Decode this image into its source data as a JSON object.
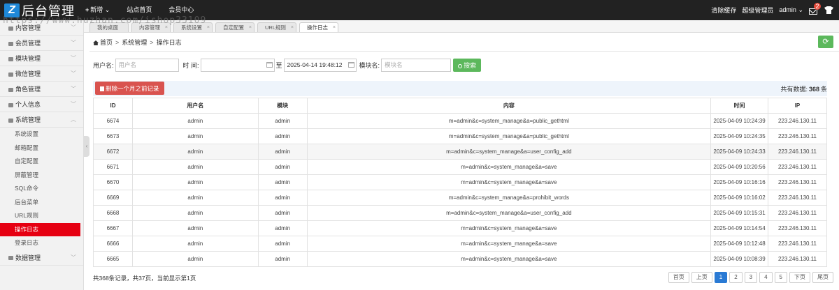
{
  "app": {
    "logo_mark": "Z",
    "logo_text": "后台管理"
  },
  "topnav": {
    "new_label": "新增",
    "site_home": "站点首页",
    "member_center": "会员中心"
  },
  "topright": {
    "clear_cache": "清除缓存",
    "role": "超级管理员",
    "user": "admin",
    "mail_count": "2"
  },
  "tabs": [
    {
      "label": "我的桌面"
    },
    {
      "label": "内容管理"
    },
    {
      "label": "系统设置"
    },
    {
      "label": "自定配置"
    },
    {
      "label": "URL规则"
    },
    {
      "label": "操作日志"
    }
  ],
  "sidebar": {
    "groups": [
      {
        "label": "内容管理"
      },
      {
        "label": "会员管理"
      },
      {
        "label": "模块管理"
      },
      {
        "label": "微信管理"
      },
      {
        "label": "角色管理"
      },
      {
        "label": "个人信息"
      },
      {
        "label": "系统管理"
      }
    ],
    "sub_items": [
      {
        "label": "系统设置"
      },
      {
        "label": "邮箱配置"
      },
      {
        "label": "自定配置"
      },
      {
        "label": "屏蔽管理"
      },
      {
        "label": "SQL命令"
      },
      {
        "label": "后台菜单"
      },
      {
        "label": "URL规则"
      },
      {
        "label": "操作日志"
      },
      {
        "label": "登录日志"
      }
    ],
    "last_group": {
      "label": "数据管理"
    }
  },
  "breadcrumb": {
    "home": "首页",
    "section": "系统管理",
    "page": "操作日志"
  },
  "search": {
    "username_label": "用户名:",
    "username_placeholder": "用户名",
    "time_label": "时 间:",
    "to_label": "至",
    "end_time_value": "2025-04-14 19:48:12",
    "module_label": "模块名:",
    "module_placeholder": "模块名",
    "button_label": "搜索"
  },
  "actions": {
    "delete_label": "删除一个月之前记录",
    "total_prefix": "共有数据:",
    "total_count": "368",
    "total_suffix": "条"
  },
  "table": {
    "headers": [
      "ID",
      "用户名",
      "模块",
      "内容",
      "时间",
      "IP"
    ],
    "rows": [
      [
        "6674",
        "admin",
        "admin",
        "m=admin&c=system_manage&a=public_gethtml",
        "2025-04-09 10:24:39",
        "223.246.130.11"
      ],
      [
        "6673",
        "admin",
        "admin",
        "m=admin&c=system_manage&a=public_gethtml",
        "2025-04-09 10:24:35",
        "223.246.130.11"
      ],
      [
        "6672",
        "admin",
        "admin",
        "m=admin&c=system_manage&a=user_config_add",
        "2025-04-09 10:24:33",
        "223.246.130.11"
      ],
      [
        "6671",
        "admin",
        "admin",
        "m=admin&c=system_manage&a=save",
        "2025-04-09 10:20:56",
        "223.246.130.11"
      ],
      [
        "6670",
        "admin",
        "admin",
        "m=admin&c=system_manage&a=save",
        "2025-04-09 10:16:16",
        "223.246.130.11"
      ],
      [
        "6669",
        "admin",
        "admin",
        "m=admin&c=system_manage&a=prohibit_words",
        "2025-04-09 10:16:02",
        "223.246.130.11"
      ],
      [
        "6668",
        "admin",
        "admin",
        "m=admin&c=system_manage&a=user_config_add",
        "2025-04-09 10:15:31",
        "223.246.130.11"
      ],
      [
        "6667",
        "admin",
        "admin",
        "m=admin&c=system_manage&a=save",
        "2025-04-09 10:14:54",
        "223.246.130.11"
      ],
      [
        "6666",
        "admin",
        "admin",
        "m=admin&c=system_manage&a=save",
        "2025-04-09 10:12:48",
        "223.246.130.11"
      ],
      [
        "6665",
        "admin",
        "admin",
        "m=admin&c=system_manage&a=save",
        "2025-04-09 10:08:39",
        "223.246.130.11"
      ]
    ]
  },
  "footer": {
    "info": "共368条记录，共37页，当前显示第1页"
  },
  "pager": [
    "首页",
    "上页",
    "1",
    "2",
    "3",
    "4",
    "5",
    "下页",
    "尾页"
  ],
  "watermark": "https://www.huzhan.com/ishop33109",
  "colors": {
    "accent_red": "#e60012",
    "green": "#5cb85c",
    "blue": "#2a7ad4",
    "topbar": "#222222"
  }
}
